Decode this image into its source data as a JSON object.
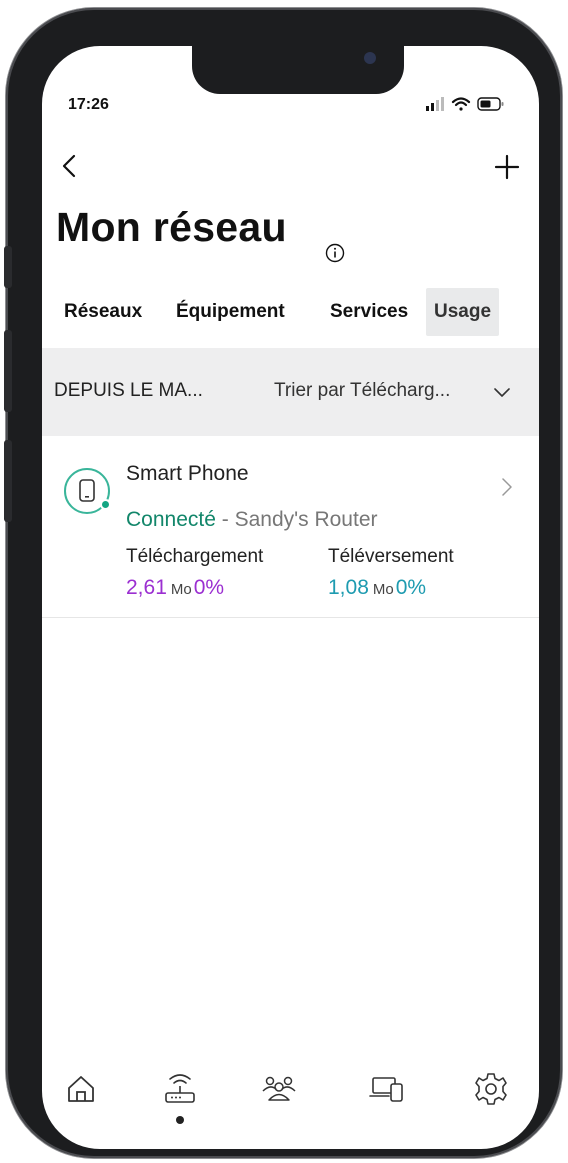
{
  "status_bar": {
    "time": "17:26"
  },
  "header": {
    "title": "Mon réseau"
  },
  "tabs": [
    {
      "label": "Réseaux"
    },
    {
      "label": "Équipement"
    },
    {
      "label": "Services"
    },
    {
      "label": "Usage",
      "active": true
    }
  ],
  "filter": {
    "period": "DEPUIS LE MA...",
    "sort": "Trier par Télécharg..."
  },
  "devices": [
    {
      "name": "Smart Phone",
      "status": "Connecté",
      "separator": " - ",
      "router": "Sandy's Router",
      "download_label": "Téléchargement",
      "download_value": "2,61",
      "download_unit": "Mo",
      "download_percent": "0%",
      "upload_label": "Téléversement",
      "upload_value": "1,08",
      "upload_unit": "Mo",
      "upload_percent": "0%"
    }
  ],
  "colors": {
    "connected": "#12866a",
    "download": "#9b2fd1",
    "upload": "#1e9bb0",
    "accent_ring": "#39b59a"
  },
  "bottom_nav": [
    {
      "icon": "home-icon"
    },
    {
      "icon": "router-icon",
      "active": true
    },
    {
      "icon": "people-icon"
    },
    {
      "icon": "devices-icon"
    },
    {
      "icon": "settings-icon"
    }
  ]
}
